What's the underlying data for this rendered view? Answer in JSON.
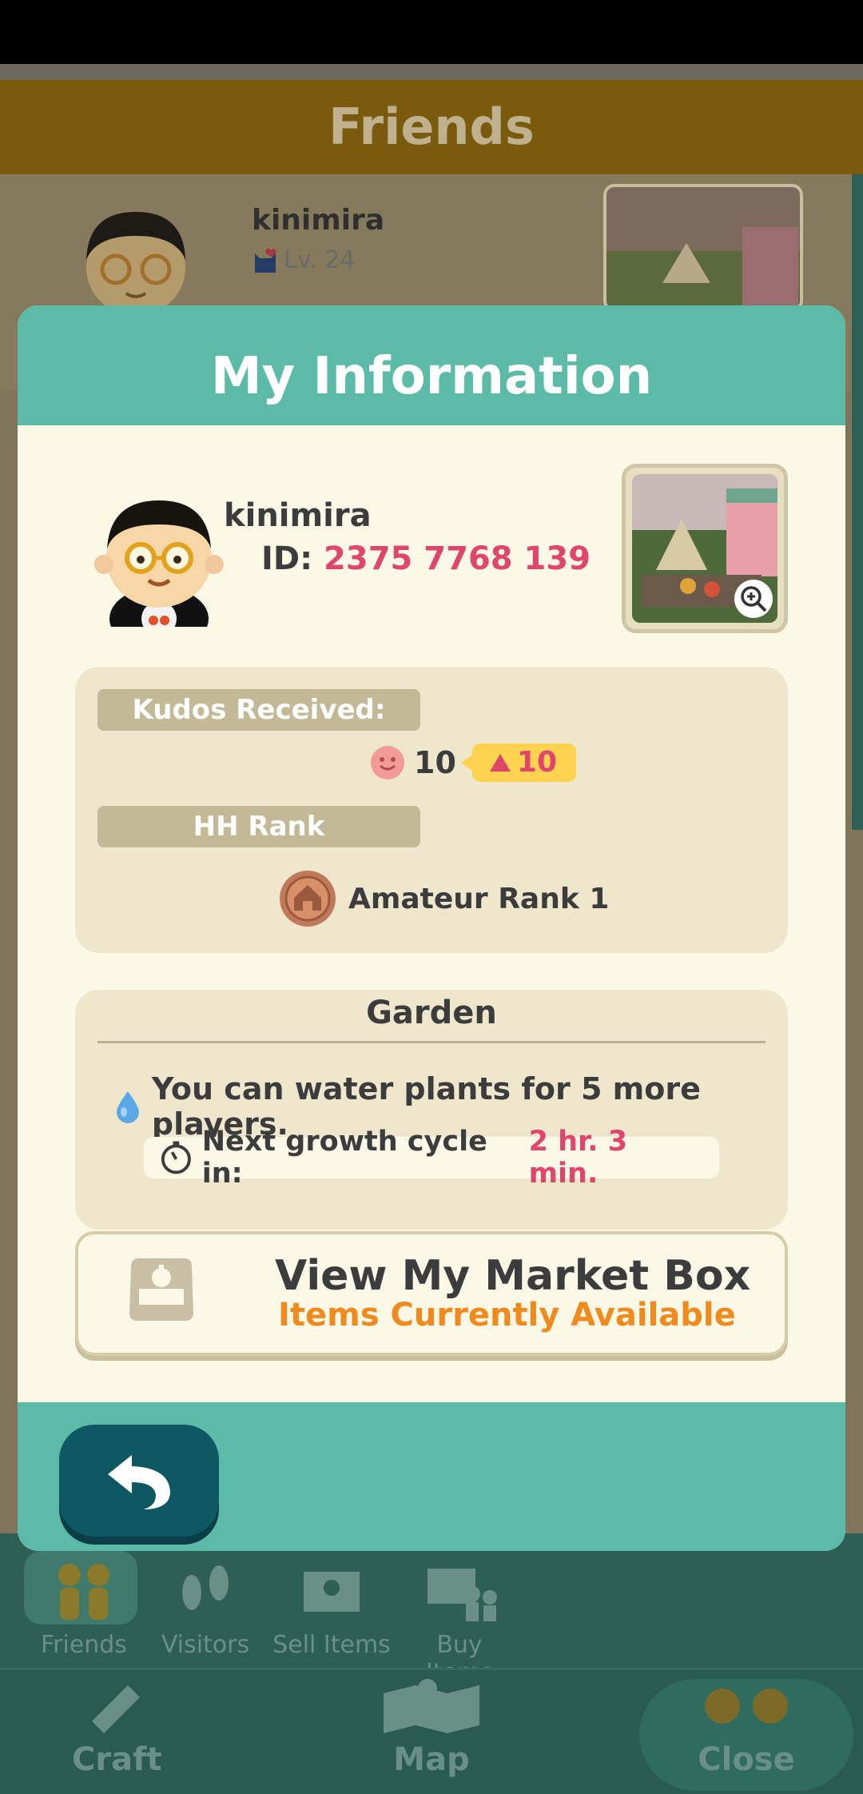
{
  "background": {
    "title": "Friends",
    "friend": {
      "name": "kinimira",
      "level": "Lv. 24"
    },
    "tabs": [
      {
        "label": "Friends"
      },
      {
        "label": "Visitors"
      },
      {
        "label": "Sell Items"
      },
      {
        "label": "Buy Items"
      }
    ],
    "bottom": {
      "craft": "Craft",
      "map": "Map",
      "close": "Close"
    }
  },
  "modal": {
    "title": "My Information",
    "name": "kinimira",
    "id_label": "ID:",
    "id_value": "2375 7768 139",
    "kudos_label": "Kudos Received:",
    "kudos_count": "10",
    "kudos_new": "10",
    "rank_label": "HH Rank",
    "rank_value": "Amateur Rank 1",
    "garden_title": "Garden",
    "water_text": "You can water plants for 5 more players.",
    "growth_label": "Next growth cycle in:",
    "growth_value": "2 hr. 3 min.",
    "market_title": "View My Market Box",
    "market_sub": "Items Currently Available"
  },
  "colors": {
    "teal": "#5bbba7",
    "accent_pink": "#e0456b",
    "accent_orange": "#f08a1c",
    "back_button": "#0e5863"
  },
  "icons": [
    "smiley-icon",
    "up-triangle-icon",
    "house-medal-icon",
    "water-drop-icon",
    "timer-icon",
    "market-box-icon",
    "zoom-icon",
    "back-arrow-icon"
  ]
}
